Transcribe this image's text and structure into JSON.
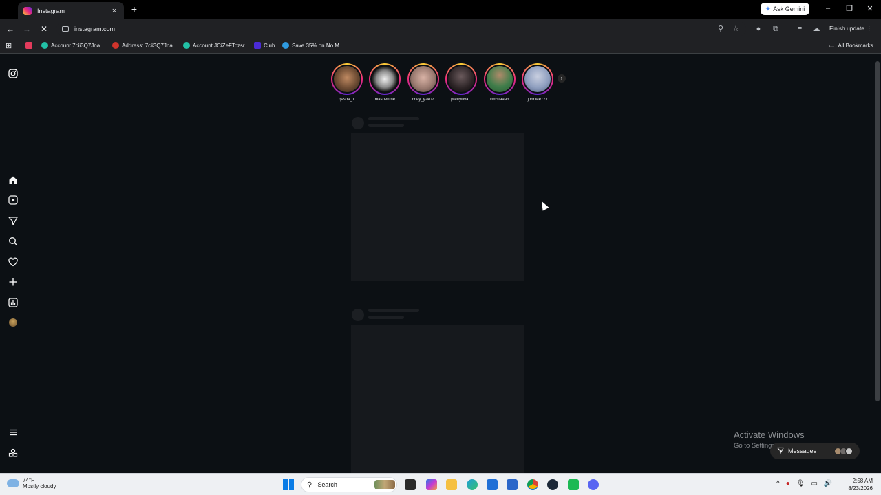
{
  "browser": {
    "tab_title": "Instagram",
    "new_tab_label": "+",
    "close_tab_label": "×",
    "ask_gemini_label": "Ask Gemini",
    "address": "instagram.com",
    "finish_update_label": "Finish update",
    "all_bookmarks_label": "All Bookmarks",
    "bookmarks": [
      {
        "label": "Account 7cii3Q7Jna...",
        "color": "#22c1a6"
      },
      {
        "label": "Address: 7cii3Q7Jna...",
        "color": "#d0342c"
      },
      {
        "label": "Account JCiZeFTczsr...",
        "color": "#22c1a6"
      },
      {
        "label": "Club",
        "color": "#4b2bd6"
      },
      {
        "label": "Save 35% on No M...",
        "color": "#2f9be0"
      }
    ]
  },
  "sidebar": {
    "icons": [
      "instagram-logo-icon",
      "home-icon",
      "reels-icon",
      "direct-icon",
      "search-icon",
      "heart-icon",
      "create-icon",
      "dashboard-icon",
      "profile-avatar",
      "menu-icon",
      "threads-icon"
    ]
  },
  "stories": [
    {
      "username": "qasda_1",
      "color": "#6b4a32"
    },
    {
      "username": "blaspehme",
      "color": "#d8d8d8"
    },
    {
      "username": "chey_y2k07",
      "color": "#9a7a70"
    },
    {
      "username": "prettylilva...",
      "color": "#2a2224"
    },
    {
      "username": "kimstaaah",
      "color": "#3f7d4a"
    },
    {
      "username": "johniee777",
      "color": "#8f9fbf"
    }
  ],
  "overlay": {
    "activate_title": "Activate Windows",
    "activate_subtitle": "Go to Settings to activate Windows.",
    "messages_label": "Messages"
  },
  "taskbar": {
    "temperature": "74°F",
    "weather": "Mostly cloudy",
    "search_placeholder": "Search",
    "time": "2:58 AM",
    "date": "8/23/2026"
  }
}
